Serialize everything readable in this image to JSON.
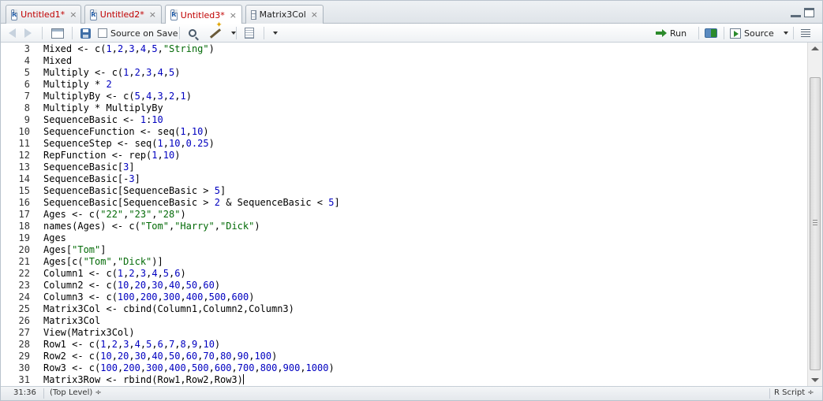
{
  "tabs": [
    {
      "label": "Untitled1*",
      "icon": "r-script-icon",
      "modified": true
    },
    {
      "label": "Untitled2*",
      "icon": "r-script-icon",
      "modified": true
    },
    {
      "label": "Untitled3*",
      "icon": "r-script-icon",
      "modified": true,
      "active": true
    },
    {
      "label": "Matrix3Col",
      "icon": "data-grid-icon",
      "modified": false
    }
  ],
  "tab_close_glyph": "×",
  "toolbar": {
    "source_on_save_label": "Source on Save",
    "run_label": "Run",
    "source_label": "Source"
  },
  "editor": {
    "lines": [
      {
        "no": "3",
        "code": "Mixed <- c(1,2,3,4,5,\"String\")"
      },
      {
        "no": "4",
        "code": "Mixed"
      },
      {
        "no": "5",
        "code": "Multiply <- c(1,2,3,4,5)"
      },
      {
        "no": "6",
        "code": "Multiply * 2"
      },
      {
        "no": "7",
        "code": "MultiplyBy <- c(5,4,3,2,1)"
      },
      {
        "no": "8",
        "code": "Multiply * MultiplyBy"
      },
      {
        "no": "9",
        "code": "SequenceBasic <- 1:10"
      },
      {
        "no": "10",
        "code": "SequenceFunction <- seq(1,10)"
      },
      {
        "no": "11",
        "code": "SequenceStep <- seq(1,10,0.25)"
      },
      {
        "no": "12",
        "code": "RepFunction <- rep(1,10)"
      },
      {
        "no": "13",
        "code": "SequenceBasic[3]"
      },
      {
        "no": "14",
        "code": "SequenceBasic[-3]"
      },
      {
        "no": "15",
        "code": "SequenceBasic[SequenceBasic > 5]"
      },
      {
        "no": "16",
        "code": "SequenceBasic[SequenceBasic > 2 & SequenceBasic < 5]"
      },
      {
        "no": "17",
        "code": "Ages <- c(\"22\",\"23\",\"28\")"
      },
      {
        "no": "18",
        "code": "names(Ages) <- c(\"Tom\",\"Harry\",\"Dick\")"
      },
      {
        "no": "19",
        "code": "Ages"
      },
      {
        "no": "20",
        "code": "Ages[\"Tom\"]"
      },
      {
        "no": "21",
        "code": "Ages[c(\"Tom\",\"Dick\")]"
      },
      {
        "no": "22",
        "code": "Column1 <- c(1,2,3,4,5,6)"
      },
      {
        "no": "23",
        "code": "Column2 <- c(10,20,30,40,50,60)"
      },
      {
        "no": "24",
        "code": "Column3 <- c(100,200,300,400,500,600)"
      },
      {
        "no": "25",
        "code": "Matrix3Col <- cbind(Column1,Column2,Column3)"
      },
      {
        "no": "26",
        "code": "Matrix3Col"
      },
      {
        "no": "27",
        "code": "View(Matrix3Col)"
      },
      {
        "no": "28",
        "code": "Row1 <- c(1,2,3,4,5,6,7,8,9,10)"
      },
      {
        "no": "29",
        "code": "Row2 <- c(10,20,30,40,50,60,70,80,90,100)"
      },
      {
        "no": "30",
        "code": "Row3 <- c(100,200,300,400,500,600,700,800,900,1000)"
      },
      {
        "no": "31",
        "code": "Matrix3Row <- rbind(Row1,Row2,Row3)"
      }
    ]
  },
  "status": {
    "cursor_position": "31:36",
    "scope": "(Top Level) ÷",
    "file_type": "R Script ÷"
  },
  "colors": {
    "modified_tab_text": "#c00000",
    "number_literal": "#0000c0",
    "string_literal": "#036a07"
  }
}
